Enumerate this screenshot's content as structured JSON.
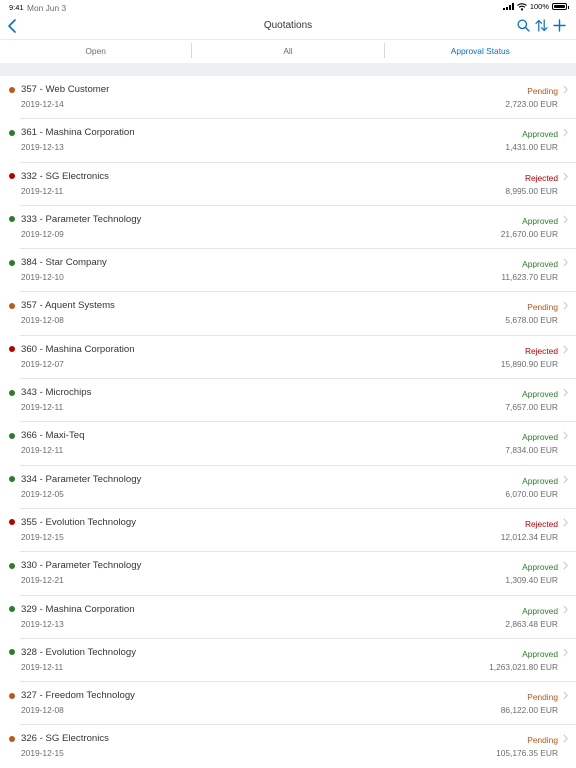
{
  "status_bar": {
    "time": "9:41",
    "date": "Mon Jun 3",
    "battery": "100%"
  },
  "nav": {
    "title": "Quotations"
  },
  "segments": [
    "Open",
    "All",
    "Approval Status"
  ],
  "colors": {
    "pending": "#c0561b",
    "approved": "#2b7d2b",
    "rejected": "#bb0000",
    "accent": "#0a6ed1"
  },
  "quotations": [
    {
      "title": "357 - Web Customer",
      "date": "2019-12-14",
      "status": "Pending",
      "amount": "2,723.00 EUR",
      "state": "pending"
    },
    {
      "title": "361 - Mashina Corporation",
      "date": "2019-12-13",
      "status": "Approved",
      "amount": "1,431.00 EUR",
      "state": "approved"
    },
    {
      "title": "332 - SG Electronics",
      "date": "2019-12-11",
      "status": "Rejected",
      "amount": "8,995.00 EUR",
      "state": "rejected"
    },
    {
      "title": "333 - Parameter Technology",
      "date": "2019-12-09",
      "status": "Approved",
      "amount": "21,670.00 EUR",
      "state": "approved"
    },
    {
      "title": "384 - Star Company",
      "date": "2019-12-10",
      "status": "Approved",
      "amount": "11,623.70 EUR",
      "state": "approved"
    },
    {
      "title": "357 - Aquent Systems",
      "date": "2019-12-08",
      "status": "Pending",
      "amount": "5,678.00 EUR",
      "state": "pending"
    },
    {
      "title": "360 - Mashina Corporation",
      "date": "2019-12-07",
      "status": "Rejected",
      "amount": "15,890.90 EUR",
      "state": "rejected"
    },
    {
      "title": "343 - Microchips",
      "date": "2019-12-11",
      "status": "Approved",
      "amount": "7,657.00 EUR",
      "state": "approved"
    },
    {
      "title": "366 - Maxi-Teq",
      "date": "2019-12-11",
      "status": "Approved",
      "amount": "7,834.00 EUR",
      "state": "approved"
    },
    {
      "title": "334 - Parameter Technology",
      "date": "2019-12-05",
      "status": "Approved",
      "amount": "6,070.00 EUR",
      "state": "approved"
    },
    {
      "title": "355 - Evolution Technology",
      "date": "2019-12-15",
      "status": "Rejected",
      "amount": "12,012.34 EUR",
      "state": "rejected"
    },
    {
      "title": "330 - Parameter Technology",
      "date": "2019-12-21",
      "status": "Approved",
      "amount": "1,309.40 EUR",
      "state": "approved"
    },
    {
      "title": "329 - Mashina Corporation",
      "date": "2019-12-13",
      "status": "Approved",
      "amount": "2,863.48 EUR",
      "state": "approved"
    },
    {
      "title": "328 - Evolution Technology",
      "date": "2019-12-11",
      "status": "Approved",
      "amount": "1,263,021.80 EUR",
      "state": "approved"
    },
    {
      "title": "327 - Freedom Technology",
      "date": "2019-12-08",
      "status": "Pending",
      "amount": "86,122.00 EUR",
      "state": "pending"
    },
    {
      "title": "326 - SG Electronics",
      "date": "2019-12-15",
      "status": "Pending",
      "amount": "105,176.35 EUR",
      "state": "pending"
    }
  ]
}
